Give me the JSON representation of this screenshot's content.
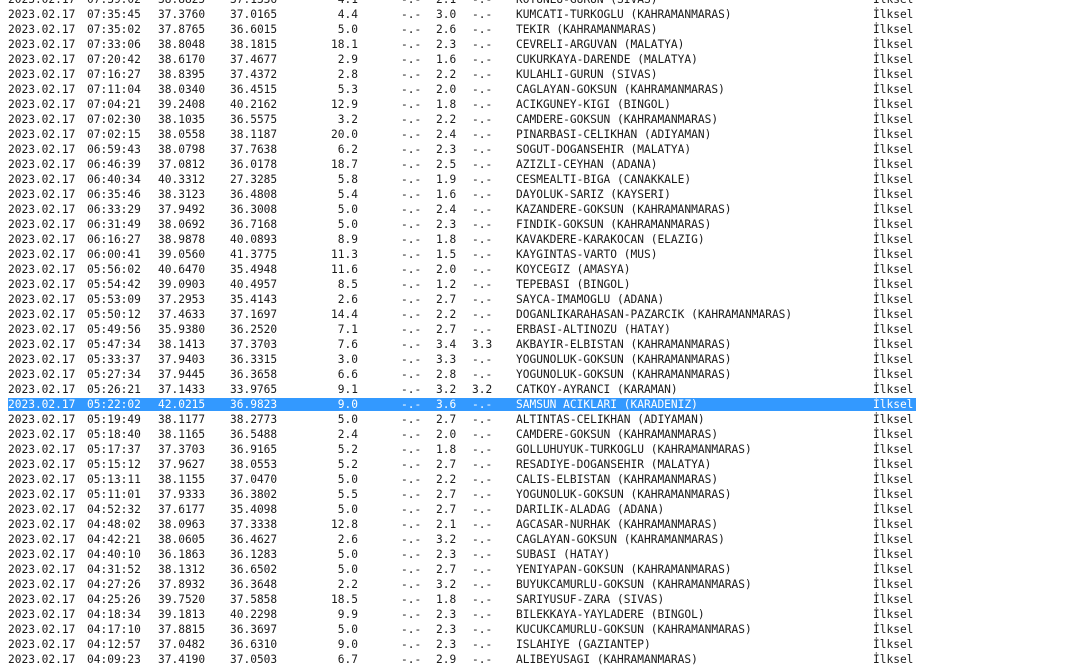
{
  "rows": [
    {
      "date": "2023.02.17",
      "time": "07:39:02",
      "lat": "38.8825",
      "lon": "37.1336",
      "depth": "4.1",
      "md": "-.-",
      "ml": "2.1",
      "mw": "-.-",
      "place": "KOYUNLU-GURUN (SIVAS)",
      "type": "İlksel"
    },
    {
      "date": "2023.02.17",
      "time": "07:35:45",
      "lat": "37.3760",
      "lon": "37.0165",
      "depth": "4.4",
      "md": "-.-",
      "ml": "3.0",
      "mw": "-.-",
      "place": "KUMCATI-TURKOGLU (KAHRAMANMARAS)",
      "type": "İlksel"
    },
    {
      "date": "2023.02.17",
      "time": "07:35:02",
      "lat": "37.8765",
      "lon": "36.6015",
      "depth": "5.0",
      "md": "-.-",
      "ml": "2.6",
      "mw": "-.-",
      "place": "TEKIR (KAHRAMANMARAS)",
      "type": "İlksel"
    },
    {
      "date": "2023.02.17",
      "time": "07:33:06",
      "lat": "38.8048",
      "lon": "38.1815",
      "depth": "18.1",
      "md": "-.-",
      "ml": "2.3",
      "mw": "-.-",
      "place": "CEVRELI-ARGUVAN (MALATYA)",
      "type": "İlksel"
    },
    {
      "date": "2023.02.17",
      "time": "07:20:42",
      "lat": "38.6170",
      "lon": "37.4677",
      "depth": "2.9",
      "md": "-.-",
      "ml": "1.6",
      "mw": "-.-",
      "place": "CUKURKAYA-DARENDE (MALATYA)",
      "type": "İlksel"
    },
    {
      "date": "2023.02.17",
      "time": "07:16:27",
      "lat": "38.8395",
      "lon": "37.4372",
      "depth": "2.8",
      "md": "-.-",
      "ml": "2.2",
      "mw": "-.-",
      "place": "KULAHLI-GURUN (SIVAS)",
      "type": "İlksel"
    },
    {
      "date": "2023.02.17",
      "time": "07:11:04",
      "lat": "38.0340",
      "lon": "36.4515",
      "depth": "5.3",
      "md": "-.-",
      "ml": "2.0",
      "mw": "-.-",
      "place": "CAGLAYAN-GOKSUN (KAHRAMANMARAS)",
      "type": "İlksel"
    },
    {
      "date": "2023.02.17",
      "time": "07:04:21",
      "lat": "39.2408",
      "lon": "40.2162",
      "depth": "12.9",
      "md": "-.-",
      "ml": "1.8",
      "mw": "-.-",
      "place": "ACIKGUNEY-KIGI (BINGOL)",
      "type": "İlksel"
    },
    {
      "date": "2023.02.17",
      "time": "07:02:30",
      "lat": "38.1035",
      "lon": "36.5575",
      "depth": "3.2",
      "md": "-.-",
      "ml": "2.2",
      "mw": "-.-",
      "place": "CAMDERE-GOKSUN (KAHRAMANMARAS)",
      "type": "İlksel"
    },
    {
      "date": "2023.02.17",
      "time": "07:02:15",
      "lat": "38.0558",
      "lon": "38.1187",
      "depth": "20.0",
      "md": "-.-",
      "ml": "2.4",
      "mw": "-.-",
      "place": "PINARBASI-CELIKHAN (ADIYAMAN)",
      "type": "İlksel"
    },
    {
      "date": "2023.02.17",
      "time": "06:59:43",
      "lat": "38.0798",
      "lon": "37.7638",
      "depth": "6.2",
      "md": "-.-",
      "ml": "2.3",
      "mw": "-.-",
      "place": "SOGUT-DOGANSEHIR (MALATYA)",
      "type": "İlksel"
    },
    {
      "date": "2023.02.17",
      "time": "06:46:39",
      "lat": "37.0812",
      "lon": "36.0178",
      "depth": "18.7",
      "md": "-.-",
      "ml": "2.5",
      "mw": "-.-",
      "place": "AZIZLI-CEYHAN (ADANA)",
      "type": "İlksel"
    },
    {
      "date": "2023.02.17",
      "time": "06:40:34",
      "lat": "40.3312",
      "lon": "27.3285",
      "depth": "5.8",
      "md": "-.-",
      "ml": "1.9",
      "mw": "-.-",
      "place": "CESMEALTI-BIGA (CANAKKALE)",
      "type": "İlksel"
    },
    {
      "date": "2023.02.17",
      "time": "06:35:46",
      "lat": "38.3123",
      "lon": "36.4808",
      "depth": "5.4",
      "md": "-.-",
      "ml": "1.6",
      "mw": "-.-",
      "place": "DAYOLUK-SARIZ (KAYSERI)",
      "type": "İlksel"
    },
    {
      "date": "2023.02.17",
      "time": "06:33:29",
      "lat": "37.9492",
      "lon": "36.3008",
      "depth": "5.0",
      "md": "-.-",
      "ml": "2.4",
      "mw": "-.-",
      "place": "KAZANDERE-GOKSUN (KAHRAMANMARAS)",
      "type": "İlksel"
    },
    {
      "date": "2023.02.17",
      "time": "06:31:49",
      "lat": "38.0692",
      "lon": "36.7168",
      "depth": "5.0",
      "md": "-.-",
      "ml": "2.3",
      "mw": "-.-",
      "place": "FINDIK-GOKSUN (KAHRAMANMARAS)",
      "type": "İlksel"
    },
    {
      "date": "2023.02.17",
      "time": "06:16:27",
      "lat": "38.9878",
      "lon": "40.0893",
      "depth": "8.9",
      "md": "-.-",
      "ml": "1.8",
      "mw": "-.-",
      "place": "KAVAKDERE-KARAKOCAN (ELAZIG)",
      "type": "İlksel"
    },
    {
      "date": "2023.02.17",
      "time": "06:00:41",
      "lat": "39.0560",
      "lon": "41.3775",
      "depth": "11.3",
      "md": "-.-",
      "ml": "1.5",
      "mw": "-.-",
      "place": "KAYGINTAS-VARTO (MUS)",
      "type": "İlksel"
    },
    {
      "date": "2023.02.17",
      "time": "05:56:02",
      "lat": "40.6470",
      "lon": "35.4948",
      "depth": "11.6",
      "md": "-.-",
      "ml": "2.0",
      "mw": "-.-",
      "place": "KOYCEGIZ (AMASYA)",
      "type": "İlksel"
    },
    {
      "date": "2023.02.17",
      "time": "05:54:42",
      "lat": "39.0903",
      "lon": "40.4957",
      "depth": "8.5",
      "md": "-.-",
      "ml": "1.2",
      "mw": "-.-",
      "place": "TEPEBASI (BINGOL)",
      "type": "İlksel"
    },
    {
      "date": "2023.02.17",
      "time": "05:53:09",
      "lat": "37.2953",
      "lon": "35.4143",
      "depth": "2.6",
      "md": "-.-",
      "ml": "2.7",
      "mw": "-.-",
      "place": "SAYCA-IMAMOGLU (ADANA)",
      "type": "İlksel"
    },
    {
      "date": "2023.02.17",
      "time": "05:50:12",
      "lat": "37.4633",
      "lon": "37.1697",
      "depth": "14.4",
      "md": "-.-",
      "ml": "2.2",
      "mw": "-.-",
      "place": "DOGANLIKARAHASAN-PAZARCIK (KAHRAMANMARAS)",
      "type": "İlksel"
    },
    {
      "date": "2023.02.17",
      "time": "05:49:56",
      "lat": "35.9380",
      "lon": "36.2520",
      "depth": "7.1",
      "md": "-.-",
      "ml": "2.7",
      "mw": "-.-",
      "place": "ERBASI-ALTINOZU (HATAY)",
      "type": "İlksel"
    },
    {
      "date": "2023.02.17",
      "time": "05:47:34",
      "lat": "38.1413",
      "lon": "37.3703",
      "depth": "7.6",
      "md": "-.-",
      "ml": "3.4",
      "mw": "3.3",
      "place": "AKBAYIR-ELBISTAN (KAHRAMANMARAS)",
      "type": "İlksel"
    },
    {
      "date": "2023.02.17",
      "time": "05:33:37",
      "lat": "37.9403",
      "lon": "36.3315",
      "depth": "3.0",
      "md": "-.-",
      "ml": "3.3",
      "mw": "-.-",
      "place": "YOGUNOLUK-GOKSUN (KAHRAMANMARAS)",
      "type": "İlksel"
    },
    {
      "date": "2023.02.17",
      "time": "05:27:34",
      "lat": "37.9445",
      "lon": "36.3658",
      "depth": "6.6",
      "md": "-.-",
      "ml": "2.8",
      "mw": "-.-",
      "place": "YOGUNOLUK-GOKSUN (KAHRAMANMARAS)",
      "type": "İlksel"
    },
    {
      "date": "2023.02.17",
      "time": "05:26:21",
      "lat": "37.1433",
      "lon": "33.9765",
      "depth": "9.1",
      "md": "-.-",
      "ml": "3.2",
      "mw": "3.2",
      "place": "CATKOY-AYRANCI (KARAMAN)",
      "type": "İlksel"
    },
    {
      "date": "2023.02.17",
      "time": "05:22:02",
      "lat": "42.0215",
      "lon": "36.9823",
      "depth": "9.0",
      "md": "-.-",
      "ml": "3.6",
      "mw": "-.-",
      "place": "SAMSUN ACIKLARI (KARADENIZ)",
      "type": "İlksel",
      "selected": true
    },
    {
      "date": "2023.02.17",
      "time": "05:19:49",
      "lat": "38.1177",
      "lon": "38.2773",
      "depth": "5.0",
      "md": "-.-",
      "ml": "2.7",
      "mw": "-.-",
      "place": "ALTINTAS-CELIKHAN (ADIYAMAN)",
      "type": "İlksel"
    },
    {
      "date": "2023.02.17",
      "time": "05:18:40",
      "lat": "38.1165",
      "lon": "36.5488",
      "depth": "2.4",
      "md": "-.-",
      "ml": "2.0",
      "mw": "-.-",
      "place": "CAMDERE-GOKSUN (KAHRAMANMARAS)",
      "type": "İlksel"
    },
    {
      "date": "2023.02.17",
      "time": "05:17:37",
      "lat": "37.3703",
      "lon": "36.9165",
      "depth": "5.2",
      "md": "-.-",
      "ml": "1.8",
      "mw": "-.-",
      "place": "GOLLUHUYUK-TURKOGLU (KAHRAMANMARAS)",
      "type": "İlksel"
    },
    {
      "date": "2023.02.17",
      "time": "05:15:12",
      "lat": "37.9627",
      "lon": "38.0553",
      "depth": "5.2",
      "md": "-.-",
      "ml": "2.7",
      "mw": "-.-",
      "place": "RESADIYE-DOGANSEHIR (MALATYA)",
      "type": "İlksel"
    },
    {
      "date": "2023.02.17",
      "time": "05:13:11",
      "lat": "38.1155",
      "lon": "37.0470",
      "depth": "5.0",
      "md": "-.-",
      "ml": "2.2",
      "mw": "-.-",
      "place": "CALIS-ELBISTAN (KAHRAMANMARAS)",
      "type": "İlksel"
    },
    {
      "date": "2023.02.17",
      "time": "05:11:01",
      "lat": "37.9333",
      "lon": "36.3802",
      "depth": "5.5",
      "md": "-.-",
      "ml": "2.7",
      "mw": "-.-",
      "place": "YOGUNOLUK-GOKSUN (KAHRAMANMARAS)",
      "type": "İlksel"
    },
    {
      "date": "2023.02.17",
      "time": "04:52:32",
      "lat": "37.6177",
      "lon": "35.4098",
      "depth": "5.0",
      "md": "-.-",
      "ml": "2.7",
      "mw": "-.-",
      "place": "DARILIK-ALADAG (ADANA)",
      "type": "İlksel"
    },
    {
      "date": "2023.02.17",
      "time": "04:48:02",
      "lat": "38.0963",
      "lon": "37.3338",
      "depth": "12.8",
      "md": "-.-",
      "ml": "2.1",
      "mw": "-.-",
      "place": "AGCASAR-NURHAK (KAHRAMANMARAS)",
      "type": "İlksel"
    },
    {
      "date": "2023.02.17",
      "time": "04:42:21",
      "lat": "38.0605",
      "lon": "36.4627",
      "depth": "2.6",
      "md": "-.-",
      "ml": "3.2",
      "mw": "-.-",
      "place": "CAGLAYAN-GOKSUN (KAHRAMANMARAS)",
      "type": "İlksel"
    },
    {
      "date": "2023.02.17",
      "time": "04:40:10",
      "lat": "36.1863",
      "lon": "36.1283",
      "depth": "5.0",
      "md": "-.-",
      "ml": "2.3",
      "mw": "-.-",
      "place": "SUBASI (HATAY)",
      "type": "İlksel"
    },
    {
      "date": "2023.02.17",
      "time": "04:31:52",
      "lat": "38.1312",
      "lon": "36.6502",
      "depth": "5.0",
      "md": "-.-",
      "ml": "2.7",
      "mw": "-.-",
      "place": "YENIYAPAN-GOKSUN (KAHRAMANMARAS)",
      "type": "İlksel"
    },
    {
      "date": "2023.02.17",
      "time": "04:27:26",
      "lat": "37.8932",
      "lon": "36.3648",
      "depth": "2.2",
      "md": "-.-",
      "ml": "3.2",
      "mw": "-.-",
      "place": "BUYUKCAMURLU-GOKSUN (KAHRAMANMARAS)",
      "type": "İlksel"
    },
    {
      "date": "2023.02.17",
      "time": "04:25:26",
      "lat": "39.7520",
      "lon": "37.5858",
      "depth": "18.5",
      "md": "-.-",
      "ml": "1.8",
      "mw": "-.-",
      "place": "SARIYUSUF-ZARA (SIVAS)",
      "type": "İlksel"
    },
    {
      "date": "2023.02.17",
      "time": "04:18:34",
      "lat": "39.1813",
      "lon": "40.2298",
      "depth": "9.9",
      "md": "-.-",
      "ml": "2.3",
      "mw": "-.-",
      "place": "BILEKKAYA-YAYLADERE (BINGOL)",
      "type": "İlksel"
    },
    {
      "date": "2023.02.17",
      "time": "04:17:10",
      "lat": "37.8815",
      "lon": "36.3697",
      "depth": "5.0",
      "md": "-.-",
      "ml": "2.3",
      "mw": "-.-",
      "place": "KUCUKCAMURLU-GOKSUN (KAHRAMANMARAS)",
      "type": "İlksel"
    },
    {
      "date": "2023.02.17",
      "time": "04:12:57",
      "lat": "37.0482",
      "lon": "36.6310",
      "depth": "9.0",
      "md": "-.-",
      "ml": "2.3",
      "mw": "-.-",
      "place": "ISLAHIYE (GAZIANTEP)",
      "type": "İlksel"
    },
    {
      "date": "2023.02.17",
      "time": "04:09:23",
      "lat": "37.4190",
      "lon": "37.0503",
      "depth": "6.7",
      "md": "-.-",
      "ml": "2.9",
      "mw": "-.-",
      "place": "ALIBEYUSAGI (KAHRAMANMARAS)",
      "type": "İlksel"
    }
  ],
  "colors": {
    "text": "#1a1a1a",
    "selection": "#3399ff",
    "selection_text": "#ffffff",
    "background": "#ffffff"
  }
}
